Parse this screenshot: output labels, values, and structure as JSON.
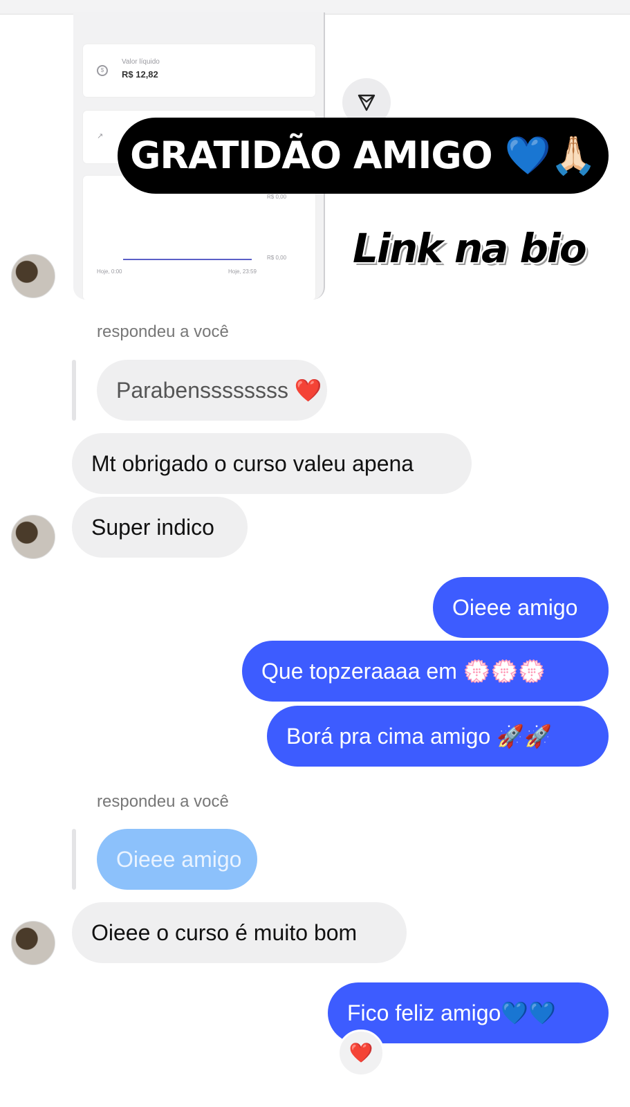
{
  "shared_post": {
    "card_label": "Valor líquido",
    "card_value": "R$ 12,82",
    "chart_label_top": "R$ 0,00",
    "chart_label_right": "R$ 0,00",
    "x_label_left": "Hoje, 0:00",
    "x_label_right": "Hoje, 23:59",
    "share_icon": "paper-plane-icon"
  },
  "overlay": {
    "banner_text": "GRATIDÃO AMIGO 💙🙏🏻",
    "link_text": "Link na bio"
  },
  "chat": {
    "reply_label_1": "respondeu a você",
    "quote_1": "Parabenssssssss ❤️",
    "msg_1": "Mt obrigado o curso valeu apena",
    "msg_2": "Super indico",
    "out_1": "Oieee amigo",
    "out_2": "Que topzeraaaa em 💮💮💮",
    "out_3": "Borá pra cima amigo 🚀🚀",
    "reply_label_2": "respondeu a você",
    "quote_2": "Oieee amigo",
    "msg_3": "Oieee o curso é muito bom",
    "out_4": "Fico feliz amigo💙💙",
    "reaction": "❤️"
  }
}
